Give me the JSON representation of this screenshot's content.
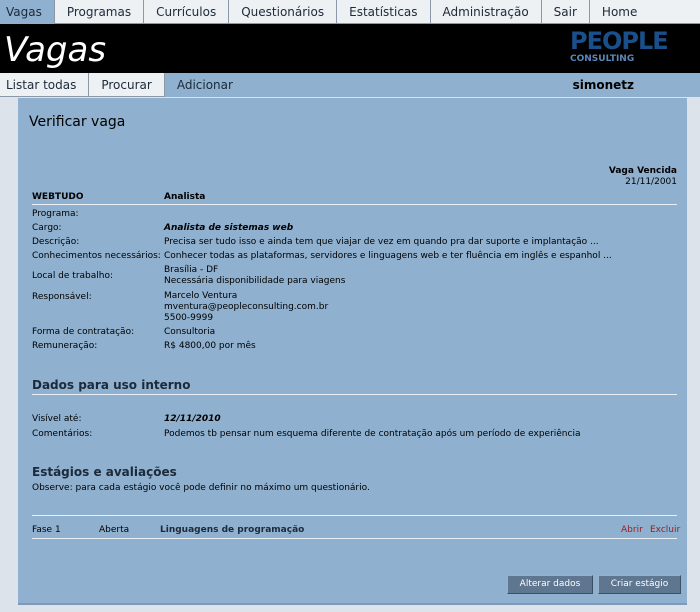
{
  "topnav": {
    "items": [
      "Vagas",
      "Programas",
      "Currículos",
      "Questionários",
      "Estatísticas",
      "Administração",
      "Sair",
      "Home"
    ]
  },
  "banner": {
    "title": "Vagas",
    "logo_big": "PEOPLE",
    "logo_small": "CONSULTING",
    "logo_color": "#1a4f8a"
  },
  "subnav": {
    "items": [
      "Listar todas",
      "Procurar",
      "Adicionar"
    ],
    "user": "simonetz"
  },
  "page": {
    "title": "Verificar vaga",
    "status_label": "Vaga Vencida",
    "status_date": "21/11/2001",
    "company": "WEBTUDO",
    "company_role": "Analista"
  },
  "details": {
    "programa_label": "Programa:",
    "programa_value": "",
    "cargo_label": "Cargo:",
    "cargo_value": "Analista de sistemas web",
    "descricao_label": "Descrição:",
    "descricao_value": "Precisa ser tudo isso e ainda tem que viajar de vez em quando pra dar suporte e implantação ...",
    "conhecimentos_label": "Conhecimentos necessários:",
    "conhecimentos_value": "Conhecer todas as plataformas, servidores e linguagens web e ter fluência em inglês e espanhol ...",
    "local_label": "Local de trabalho:",
    "local_value_1": "Brasília - DF",
    "local_value_2": "Necessária disponibilidade para viagens",
    "responsavel_label": "Responsável:",
    "responsavel_value_1": "Marcelo Ventura",
    "responsavel_value_2": "mventura@peopleconsulting.com.br",
    "responsavel_value_3": "5500-9999",
    "forma_label": "Forma de contratação:",
    "forma_value": "Consultoria",
    "remuneracao_label": "Remuneração:",
    "remuneracao_value": "R$ 4800,00 por mês"
  },
  "interno": {
    "heading": "Dados para uso interno",
    "visivel_label": "Visível até:",
    "visivel_value": "12/11/2010",
    "comentarios_label": "Comentários:",
    "comentarios_value": "Podemos tb pensar num esquema diferente de contratação após um período de experiência"
  },
  "estagios": {
    "heading": "Estágios e avaliações",
    "note": "Observe: para cada estágio você pode definir no máximo um questionário.",
    "rows": [
      {
        "fase": "Fase 1",
        "status": "Aberta",
        "nome": "Linguagens de programação",
        "abrir": "Abrir",
        "excluir": "Excluir"
      }
    ]
  },
  "buttons": {
    "alterar": "Alterar dados",
    "criar": "Criar estágio"
  }
}
